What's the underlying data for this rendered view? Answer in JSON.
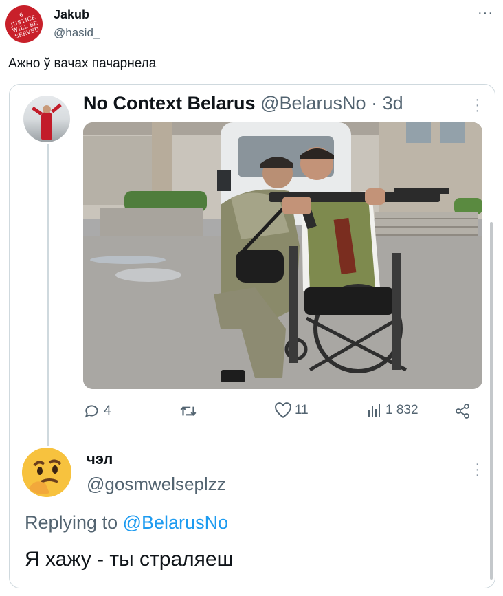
{
  "outer_tweet": {
    "avatar_text": "6\nJUSTICE\nWILL BE\nSERVED",
    "name": "Jakub",
    "handle": "@hasid_",
    "more": "···",
    "text": "Ажно ў вачах пачарнела"
  },
  "quoted_tweet": {
    "name": "No Context Belarus",
    "handle": "@BelarusNo",
    "separator": "·",
    "time": "3d",
    "photo_icon": "photo-two-men-wheelchair-rifle",
    "actions": {
      "replies": "4",
      "retweets": "",
      "likes": "11",
      "views": "1 832"
    }
  },
  "reply": {
    "name": "чэл",
    "handle": "@gosmwelseplzz",
    "replying_label": "Replying to",
    "replying_to": "@BelarusNo",
    "text": "Я хажу - ты страляеш"
  },
  "colors": {
    "text": "#0f1419",
    "secondary": "#536471",
    "accent": "#1d9bf0",
    "border": "#cfd9de",
    "avatar_red": "#c8202a"
  }
}
